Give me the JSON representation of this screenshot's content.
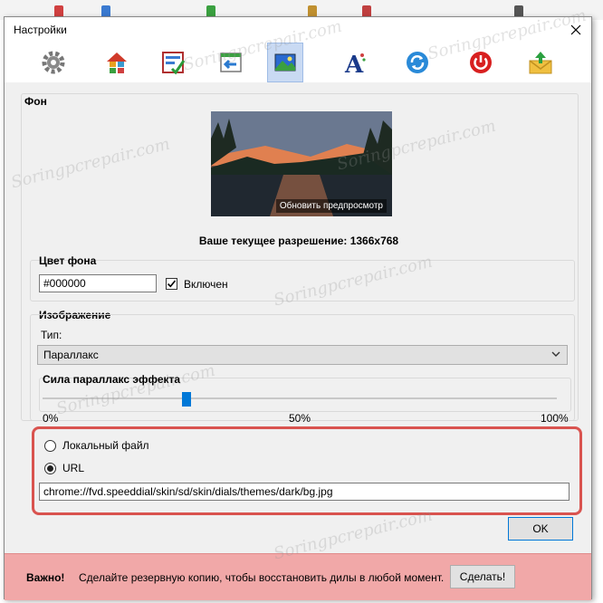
{
  "window": {
    "title": "Настройки"
  },
  "toolbar": {
    "items": [
      {
        "icon": "gear-icon"
      },
      {
        "icon": "home-icon"
      },
      {
        "icon": "checklist-icon"
      },
      {
        "icon": "import-icon"
      },
      {
        "icon": "image-background-icon"
      },
      {
        "icon": "font-icon"
      },
      {
        "icon": "sync-icon"
      },
      {
        "icon": "power-icon"
      },
      {
        "icon": "mail-icon"
      }
    ],
    "active_index": 4
  },
  "background": {
    "section_title": "Фон",
    "preview_button": "Обновить предпросмотр",
    "resolution": "Ваше текущее разрешение: 1366x768"
  },
  "bgcolor": {
    "title": "Цвет фона",
    "value": "#000000",
    "enabled_label": "Включен",
    "enabled": true
  },
  "image": {
    "title": "Изображение",
    "type_label": "Тип:",
    "type_value": "Параллакс"
  },
  "parallax": {
    "title": "Сила параллакс эффекта",
    "value_percent": 28,
    "min_label": "0%",
    "mid_label": "50%",
    "max_label": "100%"
  },
  "source": {
    "local_label": "Локальный файл",
    "url_label": "URL",
    "selected": "url",
    "url_value": "chrome://fvd.speeddial/skin/sd/skin/dials/themes/dark/bg.jpg"
  },
  "ok_label": "OK",
  "footer": {
    "warning": "Важно!",
    "message": "Сделайте резервную копию, чтобы восстановить дилы в любой момент.",
    "button": "Сделать!"
  },
  "watermark": "Soringpcrepair.com",
  "colors": {
    "accent": "#0078d7",
    "highlight_border": "#d9534f",
    "footer_bg": "#f1a8a8"
  }
}
